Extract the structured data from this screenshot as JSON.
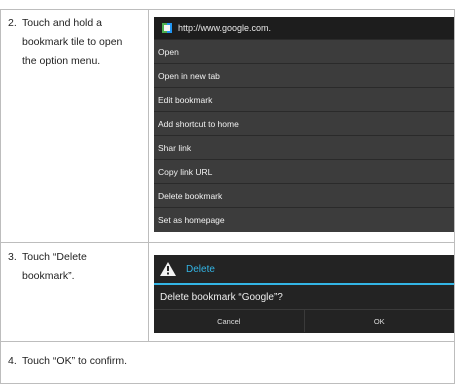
{
  "steps": [
    {
      "number": "2.",
      "text": "Touch and hold a bookmark tile to open the option menu."
    },
    {
      "number": "3.",
      "text": "Touch “Delete bookmark”."
    },
    {
      "number": "4.",
      "text": "Touch “OK” to confirm."
    }
  ],
  "menu": {
    "header_icon": "site-favicon",
    "url": "http://www.google.com.",
    "items": [
      "Open",
      "Open in new tab",
      "Edit bookmark",
      "Add shortcut to home",
      "Shar link",
      "Copy link URL",
      "Delete bookmark",
      "Set as homepage"
    ]
  },
  "dialog": {
    "icon": "warning-icon",
    "title": "Delete",
    "message": "Delete bookmark “Google”?",
    "cancel_label": "Cancel",
    "ok_label": "OK"
  },
  "colors": {
    "dialog_accent": "#33b5e5",
    "menu_background": "#3c3c3c",
    "dialog_background": "#232323"
  }
}
